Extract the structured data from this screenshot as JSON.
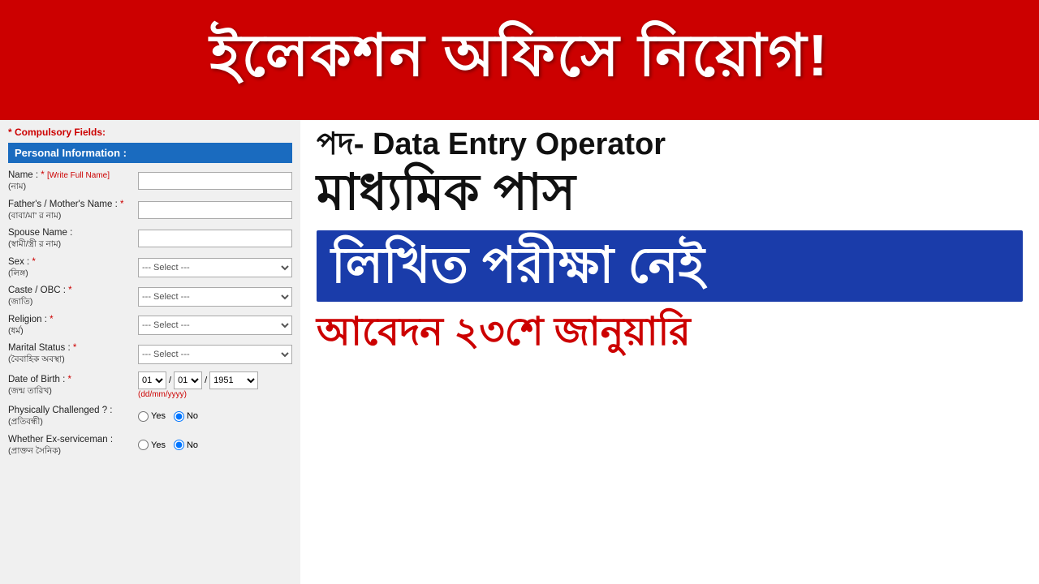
{
  "top_banner": {
    "text": "ইলেকশন অফিসে নিয়োগ!"
  },
  "form": {
    "compulsory_label": "* Compulsory Fields:",
    "section_header": "Personal Information :",
    "fields": [
      {
        "label": "Name :",
        "required": true,
        "hint": "[Write Full Name]",
        "sublabel": "(নাম)",
        "type": "text"
      },
      {
        "label": "Father's / Mother's Name :",
        "required": true,
        "sublabel": "(বাবা/মা' র নাম)",
        "type": "text"
      },
      {
        "label": "Spouse Name :",
        "required": false,
        "sublabel": "(স্বামী/স্ত্রী র নাম)",
        "type": "text"
      },
      {
        "label": "Sex :",
        "required": true,
        "sublabel": "(লিঙ্গ)",
        "type": "select",
        "placeholder": "--- Select ---"
      },
      {
        "label": "Caste / OBC :",
        "required": true,
        "sublabel": "(জাতি)",
        "type": "select",
        "placeholder": "--- Select ---"
      },
      {
        "label": "Religion :",
        "required": true,
        "sublabel": "(ধর্ম)",
        "type": "select",
        "placeholder": "--- Select ---"
      },
      {
        "label": "Marital Status :",
        "required": true,
        "sublabel": "(বৈবাহিক অবস্থা)",
        "type": "select",
        "placeholder": "--- Select ---"
      },
      {
        "label": "Date of Birth :",
        "required": true,
        "sublabel": "(জন্ম তারিখ)",
        "type": "dob",
        "dob_format": "(dd/mm/yyyy)",
        "day": "01",
        "month": "01",
        "year": "1951"
      },
      {
        "label": "Physically Challenged ? :",
        "required": false,
        "sublabel": "(প্রতিবন্ধী)",
        "type": "radio",
        "options": [
          "Yes",
          "No"
        ],
        "selected": "No"
      },
      {
        "label": "Whether Ex-serviceman :",
        "required": false,
        "sublabel": "(প্রাক্তন সৈনিক)",
        "type": "radio",
        "options": [
          "Yes",
          "No"
        ],
        "selected": "No"
      }
    ]
  },
  "info_panel": {
    "post_line": "পদ- Data Entry Operator",
    "madhyamik_line": "মাধ্যমিক পাস",
    "blue_banner_text": "লিখিত পরীক্ষা নেই",
    "application_line": "আবেদন ২৩শে জানুয়ারি"
  }
}
